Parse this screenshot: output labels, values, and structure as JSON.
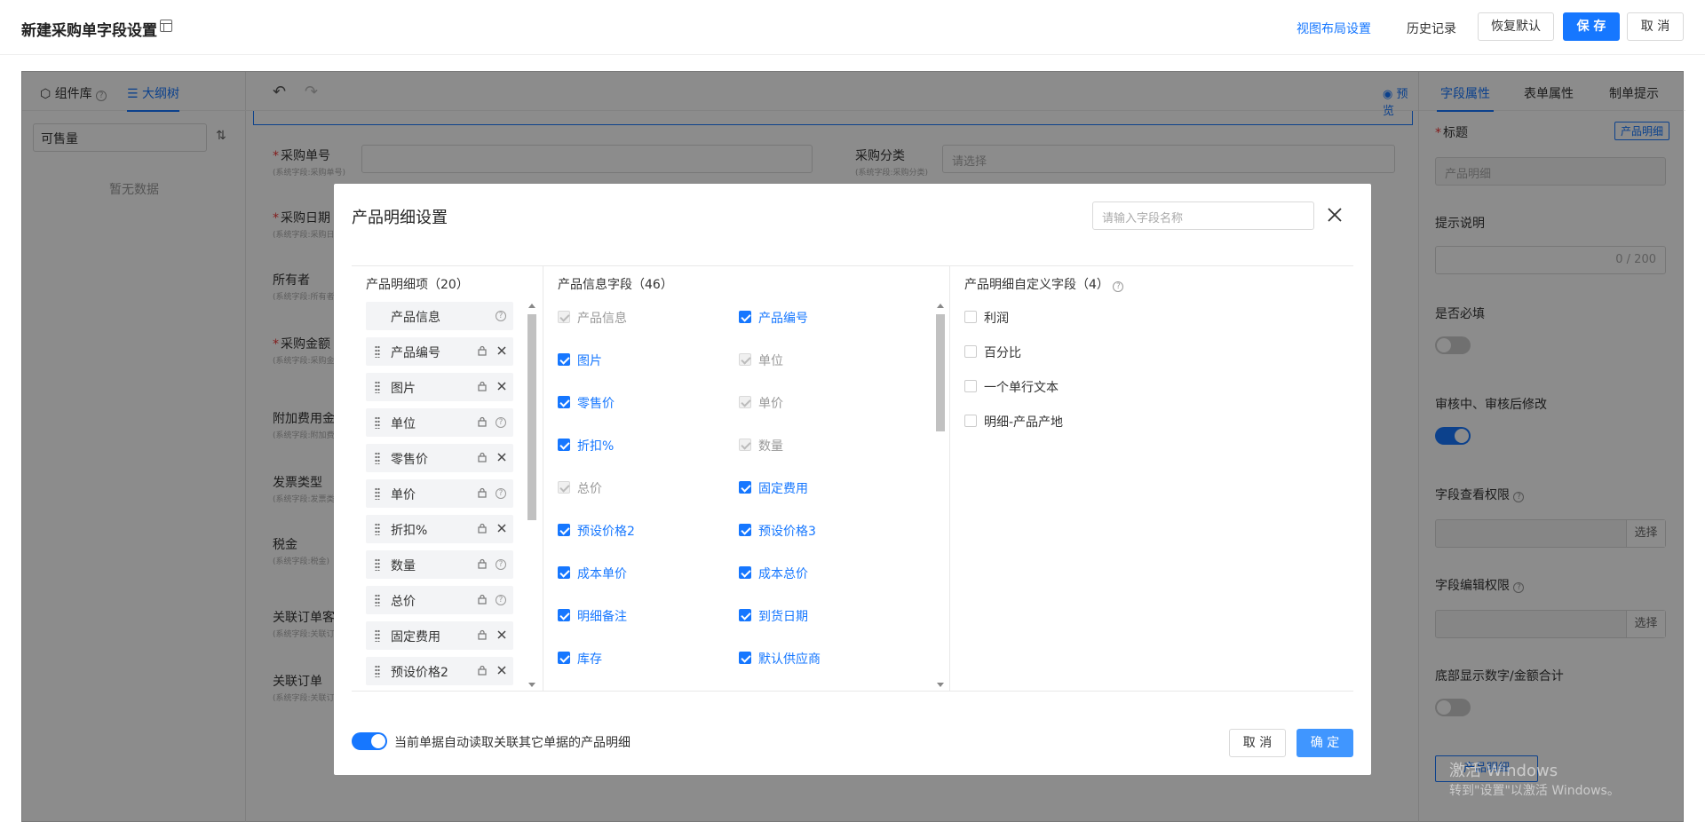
{
  "header": {
    "title": "新建采购单字段设置",
    "links": {
      "layout": "视图布局设置",
      "history": "历史记录"
    },
    "buttons": {
      "restore": "恢复默认",
      "save": "保 存",
      "cancel": "取 消"
    }
  },
  "left_panel": {
    "tabs": [
      "组件库",
      "大纲树"
    ],
    "filter_value": "可售量",
    "empty": "暂无数据"
  },
  "center": {
    "preview": "预览",
    "fields": [
      {
        "label": "采购单号",
        "sub": "(系统字段:采购单号)",
        "required": true
      },
      {
        "label": "采购日期",
        "sub": "(系统字段:采购日期)",
        "required": true
      },
      {
        "label": "所有者",
        "sub": "(系统字段:所有者)",
        "required": false
      },
      {
        "label": "采购金额",
        "sub": "(系统字段:采购金额)",
        "required": true
      },
      {
        "label": "附加费用金",
        "sub": "(系统字段:附加费用)",
        "required": false
      },
      {
        "label": "发票类型",
        "sub": "(系统字段:发票类型)",
        "required": false
      },
      {
        "label": "税金",
        "sub": "(系统字段:税金)",
        "required": false
      },
      {
        "label": "关联订单客",
        "sub": "(系统字段:关联订单客)",
        "required": false
      },
      {
        "label": "关联订单",
        "sub": "(系统字段:关联订单)",
        "required": false
      }
    ],
    "category_label": "采购分类",
    "category_sub": "(系统字段:采购分类)",
    "category_placeholder": "请选择"
  },
  "right_panel": {
    "tabs": [
      "字段属性",
      "表单属性",
      "制单提示"
    ],
    "title_label": "标题",
    "title_badge": "产品明细",
    "title_value": "产品明细",
    "hint_label": "提示说明",
    "hint_counter": "0 / 200",
    "required_label": "是否必填",
    "edit_label": "审核中、审核后修改",
    "view_perm": "字段查看权限",
    "edit_perm": "字段编辑权限",
    "select": "选择",
    "footer_total": "底部显示数字/金额合计",
    "product_button": "产品明细"
  },
  "modal": {
    "title": "产品明细设置",
    "search_placeholder": "请输入字段名称",
    "col1_title": "产品明细项（20）",
    "col2_title": "产品信息字段（46）",
    "col3_title": "产品明细自定义字段（4）",
    "items": [
      {
        "label": "产品信息",
        "action": "help",
        "handle": false
      },
      {
        "label": "产品编号",
        "action": "close",
        "handle": true
      },
      {
        "label": "图片",
        "action": "close",
        "handle": true
      },
      {
        "label": "单位",
        "action": "help",
        "handle": true
      },
      {
        "label": "零售价",
        "action": "close",
        "handle": true
      },
      {
        "label": "单价",
        "action": "help",
        "handle": true
      },
      {
        "label": "折扣%",
        "action": "close",
        "handle": true
      },
      {
        "label": "数量",
        "action": "help",
        "handle": true
      },
      {
        "label": "总价",
        "action": "help",
        "handle": true
      },
      {
        "label": "固定费用",
        "action": "close",
        "handle": true
      },
      {
        "label": "预设价格2",
        "action": "close",
        "handle": true
      }
    ],
    "info_fields": [
      {
        "label": "产品信息",
        "state": "disabled"
      },
      {
        "label": "产品编号",
        "state": "checked"
      },
      {
        "label": "图片",
        "state": "checked"
      },
      {
        "label": "单位",
        "state": "disabled"
      },
      {
        "label": "零售价",
        "state": "checked"
      },
      {
        "label": "单价",
        "state": "disabled"
      },
      {
        "label": "折扣%",
        "state": "checked"
      },
      {
        "label": "数量",
        "state": "disabled"
      },
      {
        "label": "总价",
        "state": "disabled"
      },
      {
        "label": "固定费用",
        "state": "checked"
      },
      {
        "label": "预设价格2",
        "state": "checked"
      },
      {
        "label": "预设价格3",
        "state": "checked"
      },
      {
        "label": "成本单价",
        "state": "checked"
      },
      {
        "label": "成本总价",
        "state": "checked"
      },
      {
        "label": "明细备注",
        "state": "checked"
      },
      {
        "label": "到货日期",
        "state": "checked"
      },
      {
        "label": "库存",
        "state": "checked"
      },
      {
        "label": "默认供应商",
        "state": "checked"
      }
    ],
    "custom_fields": [
      "利润",
      "百分比",
      "一个单行文本",
      "明细-产品产地"
    ],
    "footer_toggle_label": "当前单据自动读取关联其它单据的产品明细",
    "footer_toggle_on": true,
    "cancel": "取 消",
    "confirm": "确 定"
  },
  "watermark": {
    "line1": "激活 Windows",
    "line2": "转到\"设置\"以激活 Windows。"
  },
  "colors": {
    "primary": "#1677ff",
    "overlay": "rgba(0,0,0,0.45)"
  }
}
